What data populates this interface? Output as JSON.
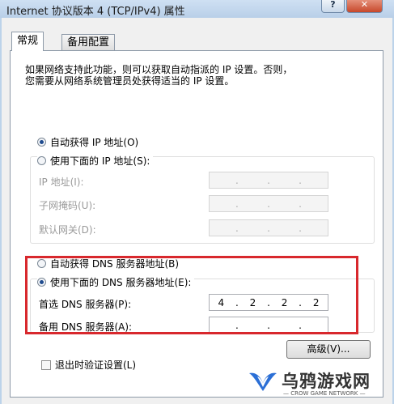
{
  "window": {
    "title": "Internet 协议版本 4 (TCP/IPv4) 属性",
    "help_label": "?",
    "close_label": "✕"
  },
  "tabs": [
    {
      "label": "常规",
      "selected": true
    },
    {
      "label": "备用配置",
      "selected": false
    }
  ],
  "description": {
    "line1": "如果网络支持此功能，则可以获取自动指派的 IP 设置。否则，",
    "line2": "您需要从网络系统管理员处获得适当的 IP 设置。"
  },
  "ip_mode": {
    "auto_label": "自动获得 IP 地址(O)",
    "manual_label": "使用下面的 IP 地址(S):",
    "selected": "auto"
  },
  "ip_fields": {
    "ip_address_label": "IP 地址(I):",
    "subnet_mask_label": "子网掩码(U):",
    "gateway_label": "默认网关(D):",
    "ip_address": [
      "",
      "",
      "",
      ""
    ],
    "subnet_mask": [
      "",
      "",
      "",
      ""
    ],
    "gateway": [
      "",
      "",
      "",
      ""
    ]
  },
  "dns_mode": {
    "auto_label": "自动获得 DNS 服务器地址(B)",
    "manual_label": "使用下面的 DNS 服务器地址(E):",
    "selected": "manual"
  },
  "dns_fields": {
    "preferred_label": "首选 DNS 服务器(P):",
    "alternate_label": "备用 DNS 服务器(A):",
    "preferred": [
      "4",
      "2",
      "2",
      "2"
    ],
    "alternate": [
      "",
      "",
      "",
      ""
    ]
  },
  "validate_on_exit": {
    "label": "退出时验证设置(L)",
    "checked": false
  },
  "advanced_button": "高级(V)...",
  "watermark": {
    "title": "乌鸦游戏网",
    "subtitle": "— CROW GAME NETWORK —"
  },
  "colors": {
    "highlight_border": "#d8282d",
    "titlebar": "#bcd3ea",
    "close_button": "#c7482b"
  }
}
